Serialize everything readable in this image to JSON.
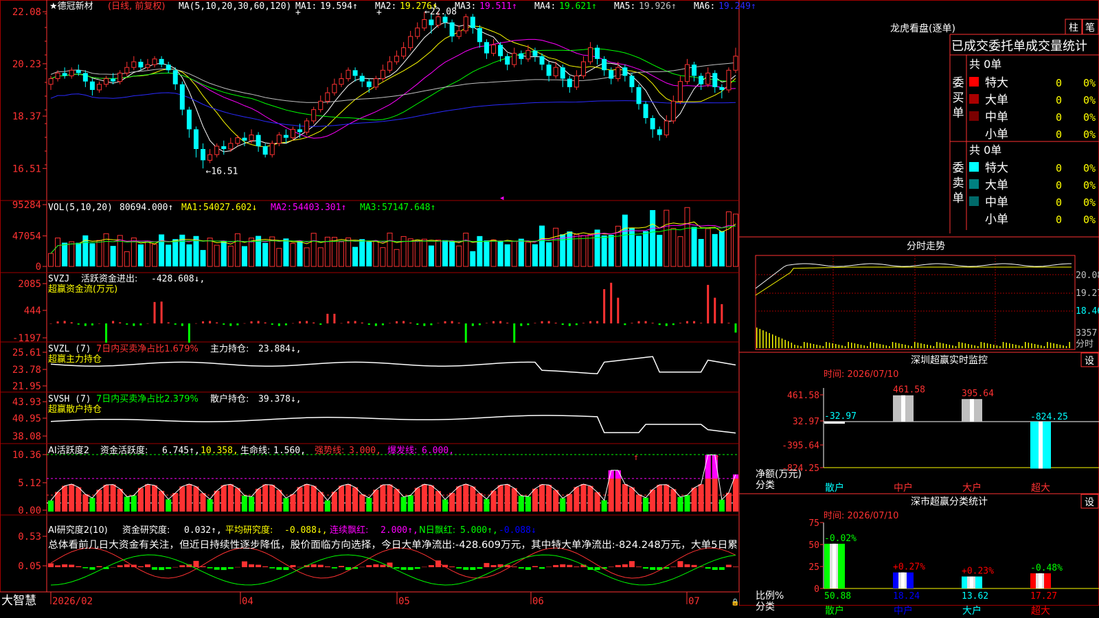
{
  "app": {
    "logo": "大智慧",
    "lock_icon": "lock-icon"
  },
  "stock": {
    "name": "德冠新材",
    "star": "★",
    "mode": "(日线, 前复权)"
  },
  "colors": {
    "up": "#ff3232",
    "down": "#00ffff",
    "grid": "#a00000",
    "axis": "#ff3232",
    "ma1": "#ffffff",
    "ma2": "#ffff00",
    "ma3": "#ff00ff",
    "ma4": "#00ff00",
    "ma5": "#c0c0c0",
    "ma6": "#2a2aff",
    "cyan": "#00ffff",
    "yellow": "#ffff00",
    "green": "#00ff00",
    "magenta": "#ff00ff",
    "red": "#ff3232",
    "blue": "#0000ff"
  },
  "main_panel": {
    "title_label": "MA(5,10,20,30,60,120)",
    "ma": [
      {
        "label": "MA1:",
        "value": "19.594↑"
      },
      {
        "label": "MA2:",
        "value": "19.276↑"
      },
      {
        "label": "MA3:",
        "value": "19.511↑"
      },
      {
        "label": "MA4:",
        "value": "19.621↑"
      },
      {
        "label": "MA5:",
        "value": "19.926↑"
      },
      {
        "label": "MA6:",
        "value": "19.249↑"
      }
    ],
    "y_ticks": [
      "22.08",
      "20.23",
      "18.37",
      "16.51"
    ],
    "high_label": "22.08",
    "low_label": "16.51"
  },
  "vol_panel": {
    "title": "VOL(5,10,20)",
    "value": "80694.000↑",
    "ma": [
      {
        "label": "MA1:",
        "value": "54027.602↓"
      },
      {
        "label": "MA2:",
        "value": "54403.301↑"
      },
      {
        "label": "MA3:",
        "value": "57147.648↑"
      }
    ],
    "y_ticks": [
      "95284",
      "47054",
      "0"
    ]
  },
  "svzj_panel": {
    "title": "SVZJ",
    "label": "活跃资金进出:",
    "value": "-428.608↓,",
    "subtitle": "超赢资金流(万元)",
    "y_ticks": [
      "2085",
      "444",
      "-1197"
    ]
  },
  "svzl_panel": {
    "title": "SVZL (7)",
    "label1": "7日内买卖净占比1.679%",
    "label2": "主力持仓:",
    "value": "23.884↓,",
    "subtitle": "超赢主力持仓",
    "y_ticks": [
      "25.61",
      "23.78",
      "21.95"
    ]
  },
  "svsh_panel": {
    "title": "SVSH (7)",
    "label1": "7日内买卖净占比2.379%",
    "label2": "散户持仓:",
    "value": "39.378↓,",
    "subtitle": "超赢散户持仓",
    "y_ticks": [
      "43.93",
      "40.95",
      "38.08"
    ]
  },
  "ai1_panel": {
    "title": "AI活跃度2",
    "label": "资金活跃度:",
    "v1": "6.745↑,",
    "v2": "10.358,",
    "label2": "生命线:",
    "v3": "1.560,",
    "label3": "强势线:",
    "v4": "3.000,",
    "label4": "爆发线:",
    "v5": "6.000,",
    "y_ticks": [
      "10.36",
      "5.12",
      "0.00"
    ]
  },
  "ai2_panel": {
    "title": "AI研究度2(10)",
    "label": "资金研究度:",
    "v1": "0.032↑,",
    "label2": "平均研究度:",
    "v2": "-0.088↓,",
    "label3": "连续飘红:",
    "v3": "2.000↑,",
    "label4": "N日飘红:",
    "v4": "5.000↑,",
    "v5": "-0.088↓",
    "comment": "总体看前几日大资金有关注，但近日持续性逐步降低，股价面临方向选择，今日大单净流出:-428.609万元，其中特大单净流出:-824.248万元，大单5日累",
    "y_ticks": [
      "0.53",
      "0.05",
      "-0.43"
    ]
  },
  "x_axis": [
    "2026/02",
    "04",
    "05",
    "06",
    "07"
  ],
  "right": {
    "lhkp_title": "龙虎看盘(逐单)",
    "btn_zhu": "柱",
    "btn_bi": "笔",
    "stats_title": "已成交委托单成交量统计",
    "buy_label": "委买单",
    "sell_label": "委卖单",
    "buy_total": "共 0单",
    "sell_total": "共 0单",
    "buy_rows": [
      {
        "name": "特大",
        "qty": "0",
        "pct": "0%"
      },
      {
        "name": "大单",
        "qty": "0",
        "pct": "0%"
      },
      {
        "name": "中单",
        "qty": "0",
        "pct": "0%"
      },
      {
        "name": "小单",
        "qty": "0",
        "pct": "0%"
      }
    ],
    "sell_rows": [
      {
        "name": "特大",
        "qty": "0",
        "pct": "0%"
      },
      {
        "name": "大单",
        "qty": "0",
        "pct": "0%"
      },
      {
        "name": "中单",
        "qty": "0",
        "pct": "0%"
      },
      {
        "name": "小单",
        "qty": "0",
        "pct": "0%"
      }
    ],
    "fenshi_title": "分时走势",
    "fenshi_ticks": [
      "20.08",
      "19.27",
      "18.46"
    ],
    "fenshi_vol": "3357",
    "fenshi_unit": "分时",
    "sz_title": "深圳超赢实时监控",
    "sz_btn": "设",
    "sz_time": "时间: 2026/07/10",
    "sz_ticks": [
      "461.58",
      "32.97",
      "-395.64",
      "-824.25"
    ],
    "sz_bars": [
      {
        "cat": "散户",
        "value": -32.97,
        "label": "-32.97"
      },
      {
        "cat": "中户",
        "value": 461.58,
        "label": "461.58"
      },
      {
        "cat": "大户",
        "value": 395.64,
        "label": "395.64"
      },
      {
        "cat": "超大",
        "value": -824.25,
        "label": "-824.25"
      }
    ],
    "sz_ylabel": "净额(万元)",
    "sz_xlabel": "分类",
    "ss_title": "深市超赢分类统计",
    "ss_btn": "设",
    "ss_time": "时间: 2026/07/10",
    "ss_ticks": [
      "75",
      "50",
      "25",
      "0"
    ],
    "ss_bars": [
      {
        "cat": "散户",
        "value": 50.88,
        "label": "50.88",
        "delta": "-0.02%"
      },
      {
        "cat": "中户",
        "value": 18.24,
        "label": "18.24",
        "delta": "+0.27%"
      },
      {
        "cat": "大户",
        "value": 13.62,
        "label": "13.62",
        "delta": "+0.23%"
      },
      {
        "cat": "超大",
        "value": 17.27,
        "label": "17.27",
        "delta": "-0.48%"
      }
    ],
    "ss_ylabel": "比例%",
    "ss_xlabel": "分类"
  },
  "chart_data": {
    "type": "candlestick",
    "note_series": "daily OHLC estimated from price axis",
    "candles": [
      [
        19.5,
        19.7,
        19.3,
        19.8
      ],
      [
        19.7,
        19.9,
        19.6,
        20.0
      ],
      [
        19.9,
        19.8,
        19.7,
        20.1
      ],
      [
        19.8,
        20.0,
        19.7,
        20.1
      ],
      [
        20.0,
        19.9,
        19.8,
        20.2
      ],
      [
        19.9,
        19.6,
        19.4,
        20.0
      ],
      [
        19.6,
        19.3,
        19.1,
        19.7
      ],
      [
        19.3,
        19.5,
        19.2,
        19.6
      ],
      [
        19.5,
        19.7,
        19.4,
        19.8
      ],
      [
        19.7,
        19.6,
        19.5,
        19.9
      ],
      [
        19.6,
        19.9,
        19.5,
        20.0
      ],
      [
        19.9,
        20.1,
        19.8,
        20.3
      ],
      [
        20.1,
        20.3,
        20.0,
        20.5
      ],
      [
        20.3,
        20.1,
        20.0,
        20.4
      ],
      [
        20.1,
        20.2,
        20.0,
        20.4
      ],
      [
        20.2,
        20.4,
        20.1,
        20.5
      ],
      [
        20.4,
        20.2,
        20.1,
        20.5
      ],
      [
        20.2,
        20.0,
        19.9,
        20.3
      ],
      [
        20.0,
        19.5,
        19.3,
        20.1
      ],
      [
        19.5,
        18.6,
        18.4,
        19.6
      ],
      [
        18.6,
        17.9,
        17.6,
        18.7
      ],
      [
        17.9,
        17.2,
        16.9,
        18.0
      ],
      [
        17.2,
        16.8,
        16.51,
        17.4
      ],
      [
        16.8,
        17.0,
        16.7,
        17.2
      ],
      [
        17.0,
        17.3,
        16.9,
        17.4
      ],
      [
        17.3,
        17.2,
        17.0,
        17.5
      ],
      [
        17.2,
        17.4,
        17.1,
        17.6
      ],
      [
        17.4,
        17.6,
        17.3,
        17.7
      ],
      [
        17.6,
        17.5,
        17.3,
        17.8
      ],
      [
        17.5,
        17.7,
        17.4,
        17.9
      ],
      [
        17.7,
        17.3,
        17.1,
        17.8
      ],
      [
        17.3,
        17.0,
        16.9,
        17.4
      ],
      [
        17.0,
        17.4,
        16.9,
        17.5
      ],
      [
        17.4,
        17.7,
        17.3,
        17.8
      ],
      [
        17.7,
        17.6,
        17.4,
        17.9
      ],
      [
        17.6,
        17.9,
        17.5,
        18.0
      ],
      [
        17.9,
        17.8,
        17.6,
        18.1
      ],
      [
        17.8,
        18.2,
        17.7,
        18.3
      ],
      [
        18.2,
        18.6,
        18.1,
        18.7
      ],
      [
        18.6,
        18.9,
        18.5,
        19.1
      ],
      [
        18.9,
        19.2,
        18.8,
        19.4
      ],
      [
        19.2,
        19.5,
        19.1,
        19.7
      ],
      [
        19.5,
        19.7,
        19.4,
        19.9
      ],
      [
        19.7,
        20.0,
        19.6,
        20.1
      ],
      [
        20.0,
        19.8,
        19.6,
        20.1
      ],
      [
        19.8,
        19.6,
        19.4,
        19.9
      ],
      [
        19.6,
        19.4,
        19.2,
        19.7
      ],
      [
        19.4,
        19.7,
        19.3,
        19.8
      ],
      [
        19.7,
        20.0,
        19.6,
        20.2
      ],
      [
        20.0,
        20.3,
        19.9,
        20.5
      ],
      [
        20.3,
        20.5,
        20.2,
        20.7
      ],
      [
        20.5,
        20.8,
        20.4,
        21.0
      ],
      [
        20.8,
        21.2,
        20.7,
        21.4
      ],
      [
        21.2,
        21.5,
        21.1,
        21.7
      ],
      [
        21.5,
        21.8,
        21.4,
        22.08
      ],
      [
        21.8,
        21.6,
        21.3,
        22.0
      ],
      [
        21.6,
        21.9,
        21.5,
        22.08
      ],
      [
        21.9,
        21.7,
        21.5,
        22.0
      ],
      [
        21.7,
        21.2,
        21.0,
        21.8
      ],
      [
        21.2,
        21.4,
        21.1,
        21.6
      ],
      [
        21.4,
        21.9,
        21.3,
        22.0
      ],
      [
        21.9,
        21.5,
        21.3,
        22.0
      ],
      [
        21.5,
        21.0,
        20.8,
        21.6
      ],
      [
        21.0,
        20.6,
        20.4,
        21.1
      ],
      [
        20.6,
        20.9,
        20.5,
        21.1
      ],
      [
        20.9,
        20.5,
        20.3,
        21.0
      ],
      [
        20.5,
        20.2,
        20.0,
        20.6
      ],
      [
        20.2,
        20.6,
        20.1,
        20.8
      ],
      [
        20.6,
        20.4,
        20.2,
        20.7
      ],
      [
        20.4,
        20.7,
        20.3,
        20.9
      ],
      [
        20.7,
        20.5,
        20.3,
        20.8
      ],
      [
        20.5,
        20.2,
        20.0,
        20.6
      ],
      [
        20.2,
        19.8,
        19.6,
        20.3
      ],
      [
        19.8,
        20.1,
        19.7,
        20.3
      ],
      [
        20.1,
        19.7,
        19.4,
        20.2
      ],
      [
        19.7,
        19.4,
        19.2,
        19.8
      ],
      [
        19.4,
        19.8,
        19.3,
        20.0
      ],
      [
        19.8,
        20.3,
        19.7,
        20.5
      ],
      [
        20.3,
        20.8,
        20.2,
        21.0
      ],
      [
        20.8,
        20.4,
        20.2,
        20.9
      ],
      [
        20.4,
        20.0,
        19.8,
        20.5
      ],
      [
        20.0,
        19.7,
        19.5,
        20.1
      ],
      [
        19.7,
        20.1,
        19.6,
        20.3
      ],
      [
        20.1,
        19.8,
        19.6,
        20.2
      ],
      [
        19.8,
        19.4,
        19.2,
        19.9
      ],
      [
        19.4,
        18.8,
        18.6,
        19.5
      ],
      [
        18.8,
        18.3,
        18.1,
        18.9
      ],
      [
        18.3,
        17.9,
        17.6,
        18.4
      ],
      [
        17.9,
        17.7,
        17.5,
        18.0
      ],
      [
        17.7,
        18.2,
        17.6,
        18.4
      ],
      [
        18.2,
        18.9,
        18.1,
        19.1
      ],
      [
        18.9,
        19.6,
        18.8,
        19.8
      ],
      [
        19.6,
        20.2,
        19.5,
        20.4
      ],
      [
        20.2,
        19.8,
        19.6,
        20.3
      ],
      [
        19.8,
        19.5,
        19.3,
        19.9
      ],
      [
        19.5,
        19.9,
        19.4,
        20.1
      ],
      [
        19.9,
        19.4,
        19.2,
        20.0
      ],
      [
        19.4,
        19.3,
        19.0,
        19.5
      ],
      [
        19.3,
        20.0,
        19.2,
        20.1
      ],
      [
        20.0,
        20.5,
        19.9,
        20.8
      ]
    ]
  }
}
